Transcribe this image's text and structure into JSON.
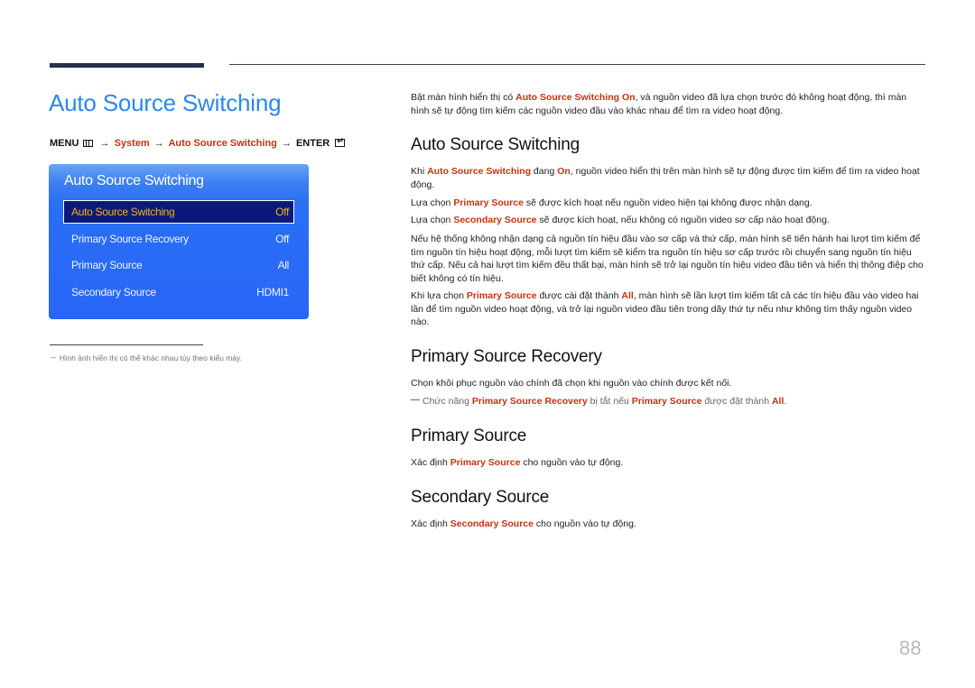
{
  "header": {
    "page_title": "Auto Source Switching"
  },
  "menu_path": {
    "menu": "MENU",
    "menu_icon": "menu-icon",
    "arrow": "→",
    "system": "System",
    "item": "Auto Source Switching",
    "enter": "ENTER",
    "enter_icon": "enter-icon"
  },
  "osd": {
    "title": "Auto Source Switching",
    "rows": [
      {
        "label": "Auto Source Switching",
        "value": "Off",
        "selected": true
      },
      {
        "label": "Primary Source Recovery",
        "value": "Off"
      },
      {
        "label": "Primary Source",
        "value": "All"
      },
      {
        "label": "Secondary Source",
        "value": "HDMI1"
      }
    ]
  },
  "footnote": "－ Hình ảnh hiển thị có thể khác nhau tùy theo kiểu máy.",
  "intro": {
    "t1": "Bật màn hình hiển thị có ",
    "hl1": "Auto Source Switching On",
    "t2": ", và nguồn video đã lựa chọn trước đó không hoạt động, thì màn hình sẽ tự động tìm kiếm các nguồn video đầu vào khác nhau để tìm ra video hoạt động."
  },
  "sections": {
    "auto": {
      "heading": "Auto Source Switching",
      "p1": {
        "t1": "Khi ",
        "hl1": "Auto Source Switching",
        "t2": " đang ",
        "hl2": "On",
        "t3": ", nguồn video hiển thị trên màn hình sẽ tự động được tìm kiếm để tìm ra video hoạt động."
      },
      "p2": {
        "t1": "Lựa chọn ",
        "hl1": "Primary Source",
        "t2": " sẽ được kích hoạt nếu nguồn video hiện tại không được nhận dạng."
      },
      "p3": {
        "t1": "Lựa chọn ",
        "hl1": "Secondary Source",
        "t2": " sẽ được kích hoạt, nếu không có nguồn video sơ cấp nào hoạt động."
      },
      "p4": "Nếu hệ thống không nhận dạng cả nguồn tín hiệu đầu vào sơ cấp và thứ cấp, màn hình sẽ tiến hành hai lượt tìm kiếm để tìm nguồn tín hiệu hoạt động, mỗi lượt tìm kiếm sẽ kiểm tra nguồn tín hiệu sơ cấp trước rồi chuyển sang nguồn tín hiệu thứ cấp. Nếu cả hai lượt tìm kiếm đều thất bại, màn hình sẽ trở lại nguồn tín hiệu video đầu tiên và hiển thị thông điệp cho biết không có tín hiệu.",
      "p5": {
        "t1": "Khi lựa chọn ",
        "hl1": "Primary Source",
        "t2": " được cài đặt thành ",
        "hl2": "All",
        "t3": ", màn hình sẽ lần lượt tìm kiếm tất cả các tín hiệu đầu vào video hai lần để tìm nguồn video hoạt động, và trở lại nguồn video đầu tiên trong dãy thứ tự nếu như không tìm thấy nguồn video nào."
      }
    },
    "recovery": {
      "heading": "Primary Source Recovery",
      "p1": "Chọn khôi phục nguồn vào chính đã chọn khi nguồn vào chính được kết nối.",
      "note": {
        "t1": "Chức năng ",
        "hl1": "Primary Source Recovery",
        "t2": " bị tắt nếu ",
        "hl2": "Primary Source",
        "t3": " được đặt thành ",
        "hl3": "All",
        "t4": "."
      }
    },
    "primary": {
      "heading": "Primary Source",
      "p1": {
        "t1": "Xác định ",
        "hl1": "Primary Source",
        "t2": " cho nguồn vào tự động."
      }
    },
    "secondary": {
      "heading": "Secondary Source",
      "p1": {
        "t1": "Xác định ",
        "hl1": "Secondary Source",
        "t2": " cho nguồn vào tự động."
      }
    }
  },
  "page_number": "88",
  "colors": {
    "title_blue": "#2b88ea",
    "highlight_red": "#c4320f",
    "osd_blue": "#2866f6",
    "osd_selected_bg": "#0b1a7a",
    "osd_selected_text": "#f2b01e"
  }
}
